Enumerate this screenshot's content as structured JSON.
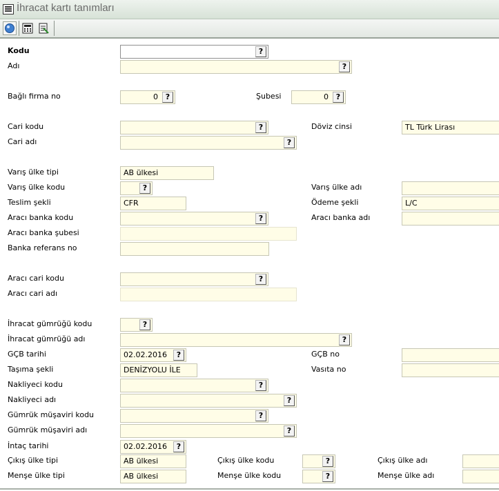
{
  "window": {
    "title": "İhracat kartı tanımları"
  },
  "toolbar": {
    "buttons": [
      {
        "name": "help-icon"
      },
      {
        "name": "calculator-icon"
      },
      {
        "name": "report-icon"
      }
    ]
  },
  "form": {
    "kodu": {
      "label": "Kodu",
      "value": "",
      "lookup": "?"
    },
    "adi": {
      "label": "Adı",
      "value": "",
      "lookup": "?"
    },
    "bagli_firma_no": {
      "label": "Bağlı firma no",
      "value": "0",
      "lookup": "?"
    },
    "subesi": {
      "label": "Şubesi",
      "value": "0",
      "lookup": "?"
    },
    "cari_kodu": {
      "label": "Cari kodu",
      "value": "",
      "lookup": "?"
    },
    "doviz_cinsi": {
      "label": "Döviz cinsi",
      "value": "TL  Türk Lirası"
    },
    "cari_adi": {
      "label": "Cari adı",
      "value": "",
      "lookup": "?"
    },
    "varis_ulke_tipi": {
      "label": "Varış ülke tipi",
      "value": "AB ülkesi"
    },
    "varis_ulke_kodu": {
      "label": "Varış ülke kodu",
      "value": "",
      "lookup": "?"
    },
    "varis_ulke_adi": {
      "label": "Varış ülke adı",
      "value": ""
    },
    "teslim_sekli": {
      "label": "Teslim şekli",
      "value": "CFR"
    },
    "odeme_sekli": {
      "label": "Ödeme şekli",
      "value": "L/C"
    },
    "araci_banka_kodu": {
      "label": "Aracı banka kodu",
      "value": "",
      "lookup": "?"
    },
    "araci_banka_adi": {
      "label": "Aracı banka adı",
      "value": ""
    },
    "araci_banka_subesi": {
      "label": "Aracı banka şubesi",
      "value": ""
    },
    "banka_referans_no": {
      "label": "Banka referans no",
      "value": ""
    },
    "araci_cari_kodu": {
      "label": "Aracı cari kodu",
      "value": "",
      "lookup": "?"
    },
    "araci_cari_adi": {
      "label": "Aracı cari adı",
      "value": ""
    },
    "ihracat_gumrugu_kodu": {
      "label": "İhracat gümrüğü kodu",
      "value": "",
      "lookup": "?"
    },
    "ihracat_gumrugu_adi": {
      "label": "İhracat gümrüğü adı",
      "value": "",
      "lookup": "?"
    },
    "gcb_tarihi": {
      "label": "GÇB tarihi",
      "value": "02.02.2016",
      "lookup": "?"
    },
    "gcb_no": {
      "label": "GÇB no",
      "value": ""
    },
    "tasima_sekli": {
      "label": "Taşıma şekli",
      "value": "DENİZYOLU İLE"
    },
    "vasita_no": {
      "label": "Vasıta no",
      "value": ""
    },
    "nakliyeci_kodu": {
      "label": "Nakliyeci kodu",
      "value": "",
      "lookup": "?"
    },
    "nakliyeci_adi": {
      "label": "Nakliyeci adı",
      "value": "",
      "lookup": "?"
    },
    "gumruk_musaviri_kodu": {
      "label": "Gümrük müşaviri kodu",
      "value": "",
      "lookup": "?"
    },
    "gumruk_musaviri_adi": {
      "label": "Gümrük müşaviri adı",
      "value": "",
      "lookup": "?"
    },
    "intac_tarihi": {
      "label": "İntaç tarihi",
      "value": "02.02.2016",
      "lookup": "?"
    },
    "cikis_ulke_tipi": {
      "label": "Çıkış ülke tipi",
      "value": "AB ülkesi"
    },
    "cikis_ulke_kodu": {
      "label": "Çıkış ülke kodu",
      "value": "",
      "lookup": "?"
    },
    "cikis_ulke_adi": {
      "label": "Çıkış ülke adı",
      "value": ""
    },
    "mense_ulke_tipi": {
      "label": "Menşe ülke tipi",
      "value": "AB ülkesi"
    },
    "mense_ulke_kodu": {
      "label": "Menşe ülke kodu",
      "value": "",
      "lookup": "?"
    },
    "mense_ulke_adi": {
      "label": "Menşe ülke adı",
      "value": ""
    }
  }
}
